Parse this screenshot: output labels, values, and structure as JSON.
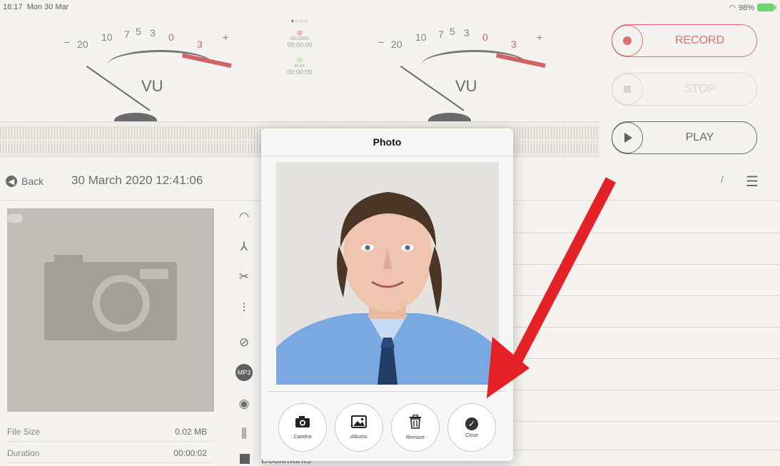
{
  "status": {
    "time": "16:17",
    "date": "Mon 30 Mar",
    "battery": "98%"
  },
  "meters": {
    "scale": [
      "–",
      "20",
      "10",
      "7",
      "5",
      "3",
      "0",
      "3",
      "+"
    ],
    "label": "VU"
  },
  "indicators": {
    "pager": "●○○○",
    "record_label": "RECORD",
    "record_time": "00:00:00",
    "play_label": "PLAY",
    "play_time": "00:00:00"
  },
  "controls": {
    "record": "RECORD",
    "stop": "STOP",
    "play": "PLAY"
  },
  "header": {
    "back": "Back",
    "title": "30 March 2020 12:41:06"
  },
  "meta": [
    {
      "key": "File Size",
      "value": "0.02 MB"
    },
    {
      "key": "Duration",
      "value": "00:00:02"
    }
  ],
  "tools": [
    "wifi-icon",
    "share-icon",
    "scissors-icon",
    "waveform-icon",
    "pencil-icon",
    "mp3-icon",
    "volume-icon",
    "split-icon"
  ],
  "bookmarks": "Bookmarks",
  "modal": {
    "title": "Photo",
    "buttons": [
      {
        "label": "Camera",
        "icon": "camera-icon"
      },
      {
        "label": "Albums",
        "icon": "albums-icon"
      },
      {
        "label": "Remove",
        "icon": "trash-icon"
      },
      {
        "label": "Close",
        "icon": "check-icon"
      }
    ]
  },
  "colors": {
    "record": "#d3383c",
    "arrow": "#e42127"
  }
}
